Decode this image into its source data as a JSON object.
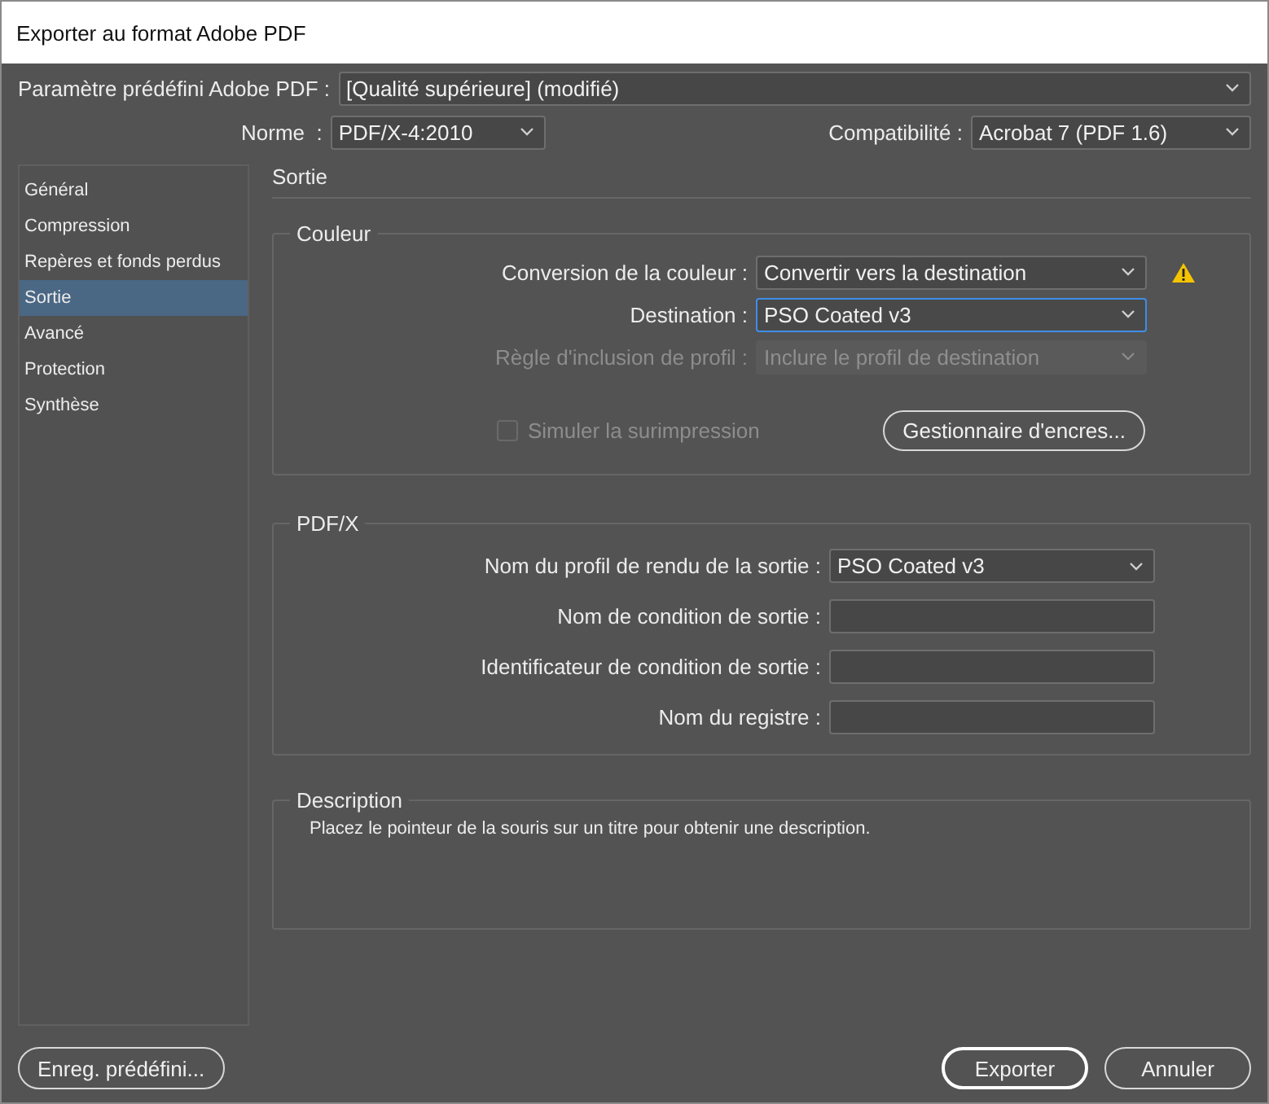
{
  "window": {
    "title": "Exporter au format Adobe PDF"
  },
  "preset": {
    "label": "Paramètre prédéfini Adobe PDF :",
    "value": "[Qualité supérieure] (modifié)"
  },
  "standard": {
    "label": "Norme  :",
    "value": "PDF/X-4:2010"
  },
  "compatibility": {
    "label": "Compatibilité :",
    "value": "Acrobat 7 (PDF 1.6)"
  },
  "sidebar": {
    "items": [
      {
        "label": "Général",
        "selected": false
      },
      {
        "label": "Compression",
        "selected": false
      },
      {
        "label": "Repères et fonds perdus",
        "selected": false
      },
      {
        "label": "Sortie",
        "selected": true
      },
      {
        "label": "Avancé",
        "selected": false
      },
      {
        "label": "Protection",
        "selected": false
      },
      {
        "label": "Synthèse",
        "selected": false
      }
    ]
  },
  "section_title": "Sortie",
  "color_group": {
    "title": "Couleur",
    "fields": [
      {
        "label": "Conversion de la couleur :",
        "value": "Convertir vers la destination",
        "disabled": false,
        "focused": false,
        "warning": true
      },
      {
        "label": "Destination :",
        "value": "PSO Coated v3",
        "disabled": false,
        "focused": true,
        "warning": false
      },
      {
        "label": "Règle d'inclusion de profil :",
        "value": "Inclure le profil de destination",
        "disabled": true,
        "focused": false,
        "warning": false
      }
    ],
    "simulate_overprint": {
      "label": "Simuler la surimpression",
      "checked": false,
      "disabled": true
    },
    "ink_manager_button": "Gestionnaire d'encres..."
  },
  "pdfx_group": {
    "title": "PDF/X",
    "fields": [
      {
        "kind": "dropdown",
        "label": "Nom du profil de rendu de la sortie :",
        "value": "PSO Coated v3"
      },
      {
        "kind": "text",
        "label": "Nom de condition de sortie :"
      },
      {
        "kind": "text",
        "label": "Identificateur de condition de sortie :"
      },
      {
        "kind": "text",
        "label": "Nom du registre :"
      }
    ]
  },
  "description": {
    "title": "Description",
    "text": "Placez le pointeur de la souris sur un titre pour obtenir une description."
  },
  "buttons": {
    "save_preset": "Enreg. prédéfini...",
    "export": "Exporter",
    "cancel": "Annuler"
  }
}
